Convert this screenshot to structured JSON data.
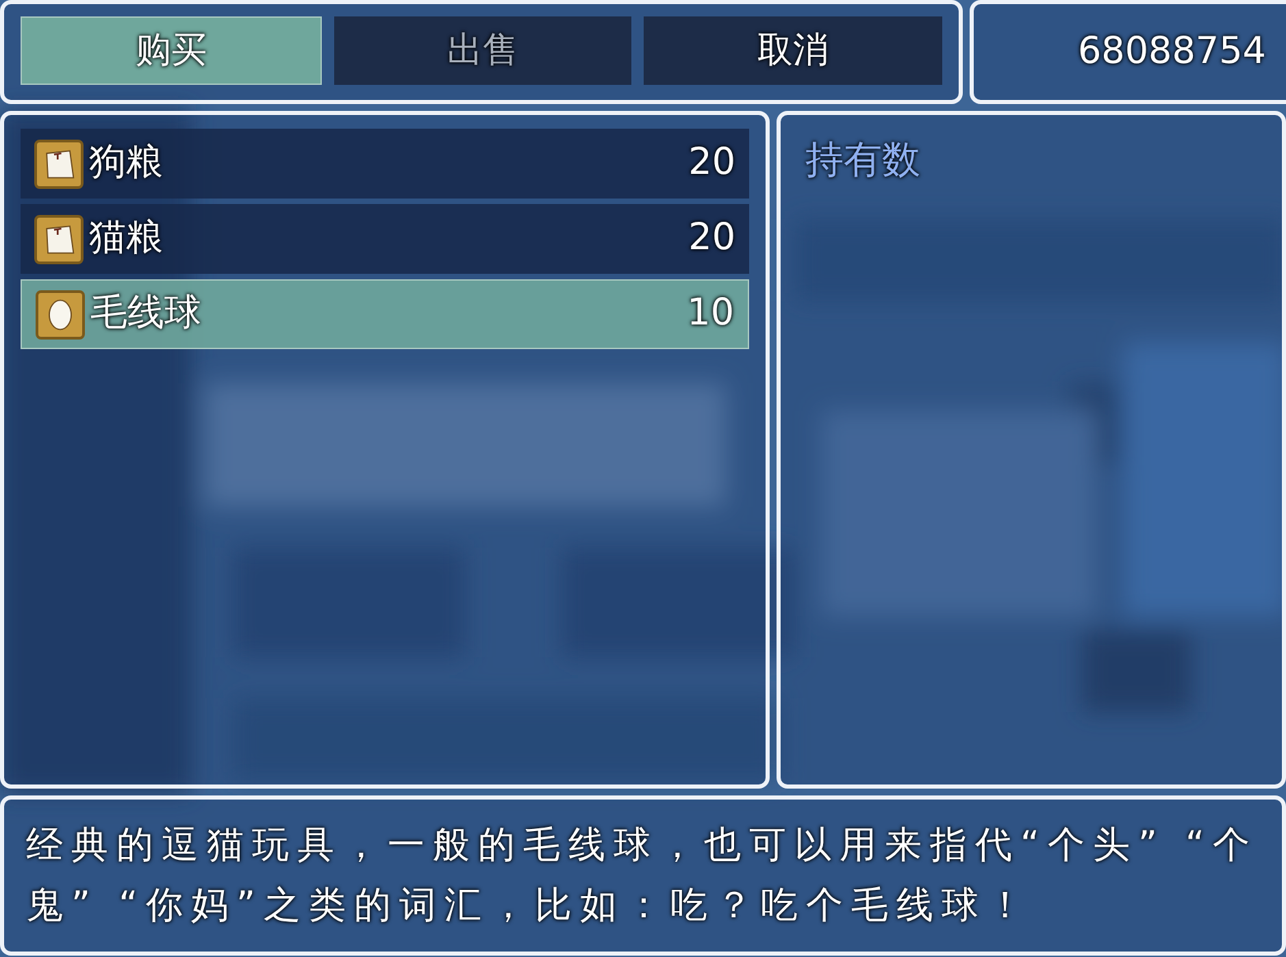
{
  "commands": [
    {
      "label": "购买",
      "selected": true,
      "disabled": false
    },
    {
      "label": "出售",
      "selected": false,
      "disabled": true
    },
    {
      "label": "取消",
      "selected": false,
      "disabled": false
    }
  ],
  "gold": {
    "amount": "68088754"
  },
  "items": [
    {
      "name": "狗粮",
      "price": "20",
      "kind": "bag",
      "selected": false
    },
    {
      "name": "猫粮",
      "price": "20",
      "kind": "bag",
      "selected": false
    },
    {
      "name": "毛线球",
      "price": "10",
      "kind": "ball",
      "selected": true
    }
  ],
  "status": {
    "label": "持有数"
  },
  "help": {
    "lines": [
      "经典的逗猫玩具，一般的毛线球，也可以用来指代“个头” “个",
      "鬼” “你妈”之类的词汇，比如：吃？吃个毛线球！"
    ]
  }
}
